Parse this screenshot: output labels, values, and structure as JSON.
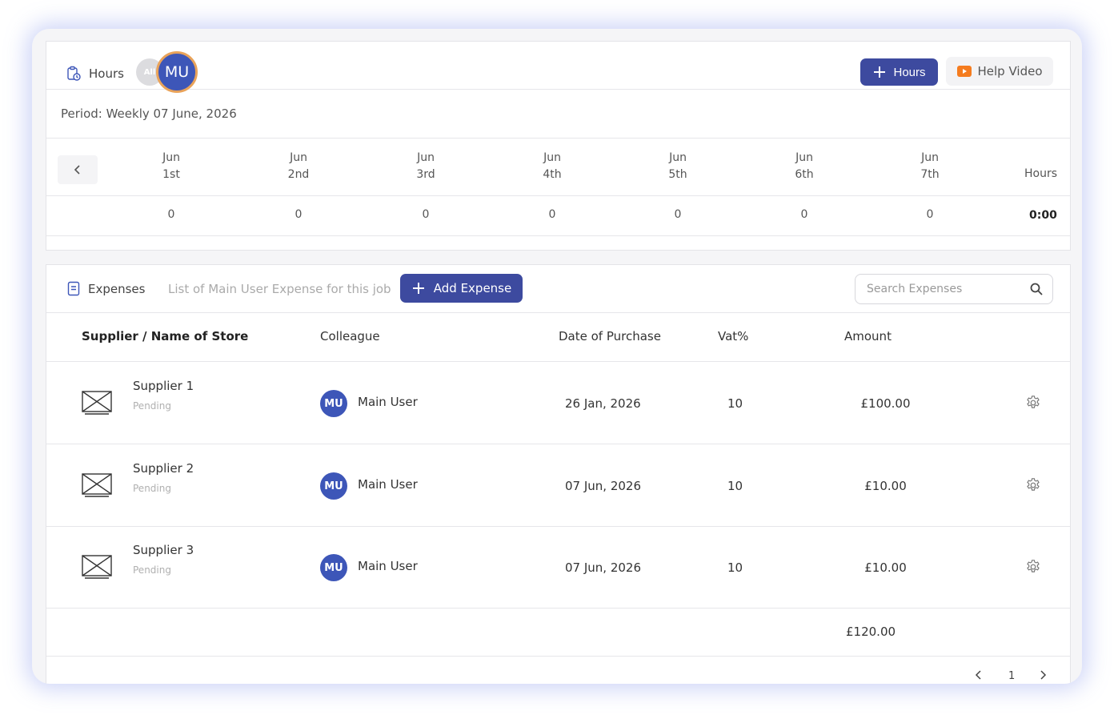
{
  "hours": {
    "title": "Hours",
    "avatar_all": "All",
    "avatar_selected": "MU",
    "add_button_label": "Hours",
    "help_button_label": "Help Video",
    "period": "Period: Weekly 07 June, 2026",
    "hours_column_label": "Hours",
    "days": [
      {
        "month": "Jun",
        "day": "1st",
        "value": "0"
      },
      {
        "month": "Jun",
        "day": "2nd",
        "value": "0"
      },
      {
        "month": "Jun",
        "day": "3rd",
        "value": "0"
      },
      {
        "month": "Jun",
        "day": "4th",
        "value": "0"
      },
      {
        "month": "Jun",
        "day": "5th",
        "value": "0"
      },
      {
        "month": "Jun",
        "day": "6th",
        "value": "0"
      },
      {
        "month": "Jun",
        "day": "7th",
        "value": "0"
      }
    ],
    "total": "0:00"
  },
  "expenses": {
    "title": "Expenses",
    "subtitle": "List of Main User Expense for this job",
    "add_button_label": "Add Expense",
    "search_placeholder": "Search Expenses",
    "columns": {
      "supplier": "Supplier / Name of Store",
      "colleague": "Colleague",
      "date": "Date of Purchase",
      "vat": "Vat%",
      "amount": "Amount"
    },
    "rows": [
      {
        "supplier": "Supplier 1",
        "status": "Pending",
        "avatar": "MU",
        "colleague": "Main User",
        "date": "26 Jan, 2026",
        "vat": "10",
        "amount": "£100.00"
      },
      {
        "supplier": "Supplier 2",
        "status": "Pending",
        "avatar": "MU",
        "colleague": "Main User",
        "date": "07 Jun, 2026",
        "vat": "10",
        "amount": "£10.00"
      },
      {
        "supplier": "Supplier 3",
        "status": "Pending",
        "avatar": "MU",
        "colleague": "Main User",
        "date": "07 Jun, 2026",
        "vat": "10",
        "amount": "£10.00"
      }
    ],
    "total": "£120.00",
    "pagination": {
      "current_page": "1"
    }
  },
  "colors": {
    "primary": "#3d4a9f",
    "avatar": "#3d56b8",
    "avatar_ring": "#e9a35a",
    "youtube": "#f57c1f",
    "glow": "#7f8ceb"
  },
  "icons": [
    "clipboard-clock-icon",
    "plus-icon",
    "youtube-icon",
    "chevron-left-icon",
    "chevron-right-icon",
    "receipt-icon",
    "search-icon",
    "image-placeholder-icon",
    "gear-icon"
  ]
}
